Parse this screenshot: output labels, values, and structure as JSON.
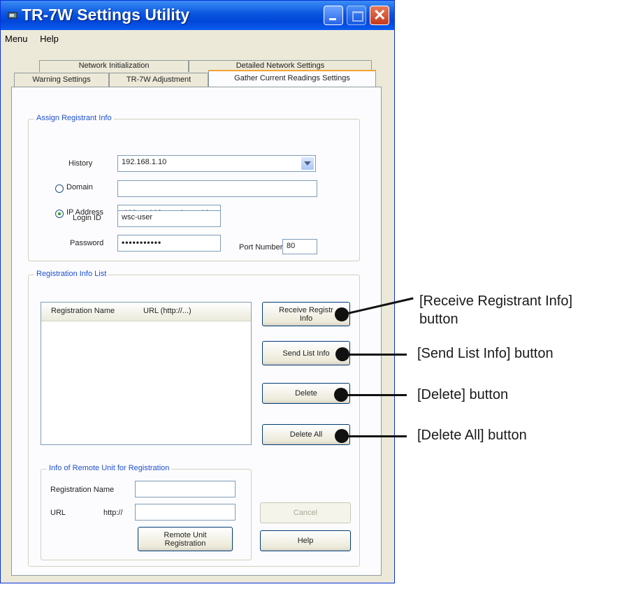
{
  "window": {
    "title": "TR-7W Settings Utility"
  },
  "menu": [
    "Menu",
    "Help"
  ],
  "tabs": {
    "back": [
      "Network Initialization",
      "Detailed Network Settings"
    ],
    "front": [
      "Warning Settings",
      "TR-7W Adjustment",
      "Gather Current Readings Settings"
    ],
    "active": "Gather Current Readings Settings"
  },
  "assign_group": {
    "label": "Assign Registrant Info",
    "history_label": "History",
    "history_value": "192.168.1.10",
    "domain_label": "Domain",
    "domain_value": "",
    "ip_label": "IP Address",
    "ip_octets": [
      "192",
      "168",
      "1",
      "10"
    ],
    "login_label": "Login ID",
    "login_value": "wsc-user",
    "password_label": "Password",
    "password_value": "•••••••••••",
    "port_label": "Port Number",
    "port_value": "80",
    "selected_radio": "IP Address"
  },
  "reg_list_group": {
    "label": "Registration Info List",
    "columns": [
      "Registration Name",
      "URL (http://...)"
    ],
    "rows": []
  },
  "buttons": {
    "receive": "Receive Registr\nInfo",
    "send_list": "Send List Info",
    "delete": "Delete",
    "delete_all": "Delete All",
    "cancel": "Cancel",
    "help": "Help",
    "remote_registration": "Remote Unit\nRegistration"
  },
  "remote_group": {
    "label": "Info of Remote Unit for Registration",
    "reg_name_label": "Registration Name",
    "reg_name_value": "",
    "url_label": "URL",
    "url_prefix": "http://",
    "url_value": ""
  },
  "callouts": [
    {
      "line1": "[Receive Registrant Info]",
      "line2": "button"
    },
    {
      "line1": "[Send List Info] button",
      "line2": ""
    },
    {
      "line1": "[Delete] button",
      "line2": ""
    },
    {
      "line1": "[Delete All] button",
      "line2": ""
    }
  ],
  "colors": {
    "titlebar": "#0a55e0",
    "active_tab_accent": "#f5a332",
    "group_label": "#2050d0",
    "callout": "#111111"
  }
}
